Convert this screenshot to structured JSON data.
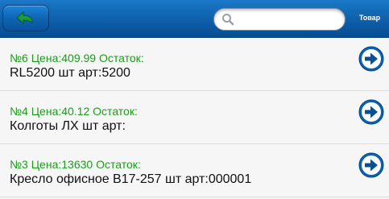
{
  "header": {
    "back_icon": "back-arrow-icon",
    "search": {
      "icon": "search-icon",
      "value": "",
      "placeholder": ""
    },
    "title": "Товар"
  },
  "colors": {
    "header_blue": "#0f61ad",
    "price_green": "#1f9a1f",
    "arrow_blue": "#0c62b2"
  },
  "items": [
    {
      "price_line": "№6 Цена:409.99 Остаток:",
      "name_line": "RL5200 шт арт:5200",
      "icon": "arrow-right-circle-icon"
    },
    {
      "price_line": "№4 Цена:40.12 Остаток:",
      "name_line": "Колготы ЛХ шт арт:",
      "icon": "arrow-right-circle-icon"
    },
    {
      "price_line": "№3 Цена:13630 Остаток:",
      "name_line": "Кресло офисное B17-257 шт арт:000001",
      "icon": "arrow-right-circle-icon"
    }
  ]
}
